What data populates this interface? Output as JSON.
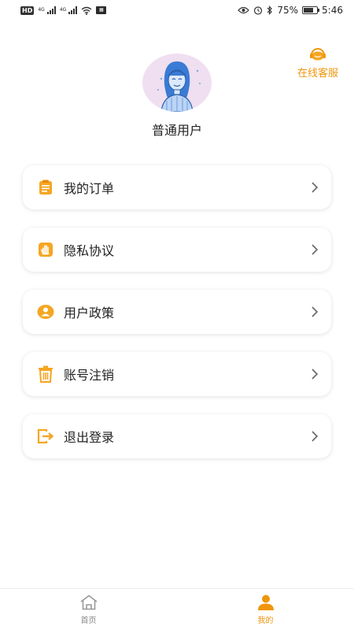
{
  "status_bar": {
    "network_badge": "HD",
    "network_type_1": "4G",
    "network_type_2": "4G",
    "battery_percent": "75%",
    "time": "5:46",
    "battery_level": 0.75
  },
  "header": {
    "service_label": "在线客服"
  },
  "profile": {
    "username": "普通用户"
  },
  "menu": {
    "items": [
      {
        "label": "我的订单",
        "icon": "order-icon"
      },
      {
        "label": "隐私协议",
        "icon": "hand-icon"
      },
      {
        "label": "用户政策",
        "icon": "user-circle-icon"
      },
      {
        "label": "账号注销",
        "icon": "trash-icon"
      },
      {
        "label": "退出登录",
        "icon": "logout-icon"
      }
    ]
  },
  "bottom_nav": {
    "home_label": "首页",
    "mine_label": "我的",
    "active": "mine"
  },
  "colors": {
    "accent": "#f0960d",
    "icon_orange": "#f5a623",
    "inactive": "#888888",
    "avatar_bg": "#efdff0",
    "avatar_figure": "#3a7bd5"
  }
}
